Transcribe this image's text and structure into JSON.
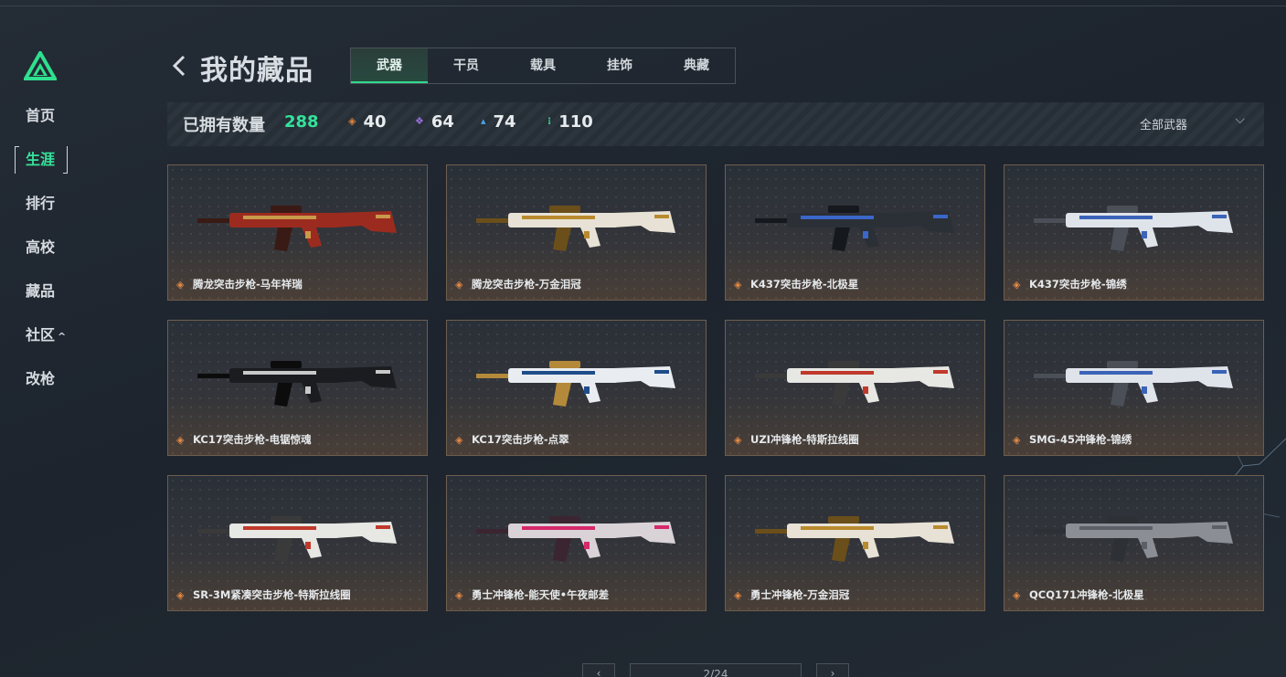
{
  "sidebar": {
    "items": [
      {
        "label": "首页",
        "active": false
      },
      {
        "label": "生涯",
        "active": true
      },
      {
        "label": "排行",
        "active": false
      },
      {
        "label": "高校",
        "active": false
      },
      {
        "label": "藏品",
        "active": false
      },
      {
        "label": "社区",
        "active": false,
        "caret": "^"
      },
      {
        "label": "改枪",
        "active": false
      }
    ]
  },
  "header": {
    "title": "我的藏品",
    "tabs": [
      "武器",
      "干员",
      "载具",
      "挂饰",
      "典藏"
    ],
    "active_tab": "武器"
  },
  "stats": {
    "owned_label": "已拥有数量",
    "owned_total": "288",
    "rarities": [
      {
        "count": "40",
        "color": "#e0823c",
        "icon": "diamond-orange-icon"
      },
      {
        "count": "64",
        "color": "#9a6ee0",
        "icon": "diamond-purple-icon"
      },
      {
        "count": "74",
        "color": "#4aa3e6",
        "icon": "diamond-blue-icon"
      },
      {
        "count": "110",
        "color": "#39c98a",
        "icon": "dots-green-icon"
      }
    ],
    "filter_label": "全部武器"
  },
  "colors": {
    "accent": "#33e39a",
    "card_border": "#6e5e4e",
    "rarity_mark": "#e58a44"
  },
  "items": [
    {
      "name": "腾龙突击步枪-马年祥瑞",
      "skin": "red"
    },
    {
      "name": "腾龙突击步枪-万金泪冠",
      "skin": "gold"
    },
    {
      "name": "K437突击步枪-北极星",
      "skin": "dark"
    },
    {
      "name": "K437突击步枪-锦绣",
      "skin": "blue"
    },
    {
      "name": "KC17突击步枪-电锯惊魂",
      "skin": "black"
    },
    {
      "name": "KC17突击步枪-点翠",
      "skin": "teal"
    },
    {
      "name": "UZI冲锋枪-特斯拉线圈",
      "skin": "white"
    },
    {
      "name": "SMG-45冲锋枪-锦绣",
      "skin": "blue"
    },
    {
      "name": "SR-3M紧凑突击步枪-特斯拉线圈",
      "skin": "white"
    },
    {
      "name": "勇士冲锋枪-能天使•午夜邮差",
      "skin": "pink"
    },
    {
      "name": "勇士冲锋枪-万金泪冠",
      "skin": "gold"
    },
    {
      "name": "QCQ171冲锋枪-北极星",
      "skin": "gray"
    }
  ],
  "pagination": {
    "prev": "‹",
    "next": "›",
    "page_text": "2/24"
  }
}
